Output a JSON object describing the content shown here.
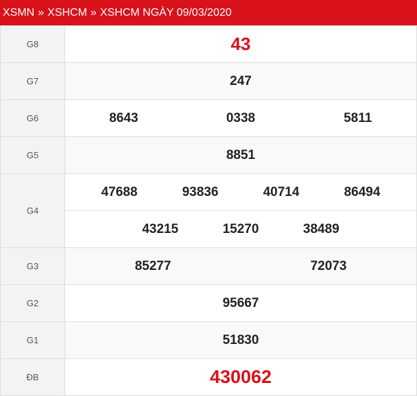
{
  "header": {
    "crumb1": "XSMN",
    "sep": "»",
    "crumb2": "XSHCM",
    "title": "XSHCM NGÀY 09/03/2020"
  },
  "prizes": {
    "g8": {
      "label": "G8",
      "numbers": [
        "43"
      ]
    },
    "g7": {
      "label": "G7",
      "numbers": [
        "247"
      ]
    },
    "g6": {
      "label": "G6",
      "numbers": [
        "8643",
        "0338",
        "5811"
      ]
    },
    "g5": {
      "label": "G5",
      "numbers": [
        "8851"
      ]
    },
    "g4": {
      "label": "G4",
      "numbers": [
        "47688",
        "93836",
        "40714",
        "86494",
        "43215",
        "15270",
        "38489"
      ]
    },
    "g3": {
      "label": "G3",
      "numbers": [
        "85277",
        "72073"
      ]
    },
    "g2": {
      "label": "G2",
      "numbers": [
        "95667"
      ]
    },
    "g1": {
      "label": "G1",
      "numbers": [
        "51830"
      ]
    },
    "db": {
      "label": "ĐB",
      "numbers": [
        "430062"
      ]
    }
  },
  "colors": {
    "accent": "#d9111b",
    "label_bg": "#f3f3f3",
    "border": "#dddddd"
  }
}
